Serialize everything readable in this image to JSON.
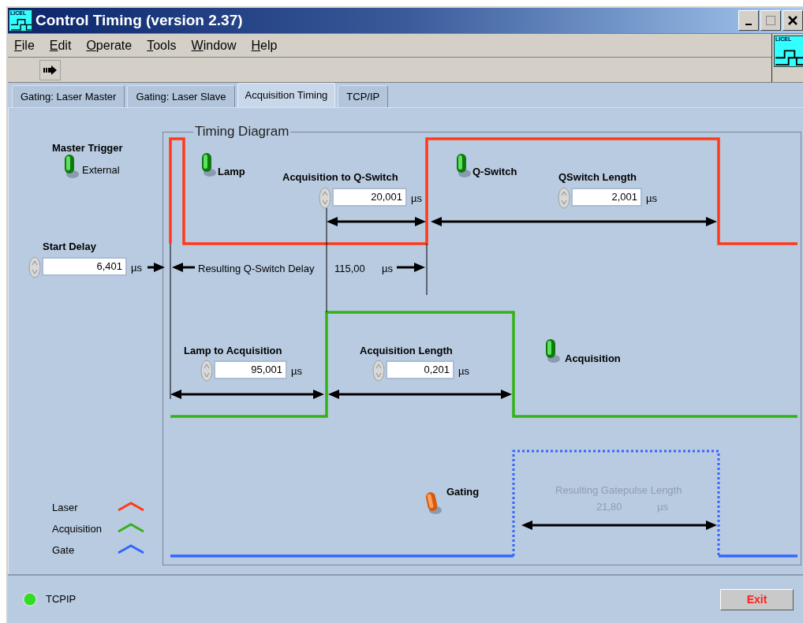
{
  "window": {
    "title": "Control Timing (version 2.37)",
    "logo_text": "LICEL"
  },
  "menu": [
    {
      "label": "File"
    },
    {
      "label": "Edit"
    },
    {
      "label": "Operate"
    },
    {
      "label": "Tools"
    },
    {
      "label": "Window"
    },
    {
      "label": "Help"
    }
  ],
  "toolbar": {
    "logo_text": "LICEL"
  },
  "tabs": [
    {
      "label": "Gating: Laser Master",
      "selected": false
    },
    {
      "label": "Gating: Laser Slave",
      "selected": false
    },
    {
      "label": "Acquisition Timing",
      "selected": true
    },
    {
      "label": "TCP/IP",
      "selected": false
    }
  ],
  "diagram": {
    "title": "Timing Diagram"
  },
  "switches": [
    {
      "label": "Master Trigger",
      "caption": "External",
      "on": true
    },
    {
      "label": "Lamp",
      "on": true
    },
    {
      "label": "Q-Switch",
      "on": true
    },
    {
      "label": "Acquisition",
      "on": true
    },
    {
      "label": "Gating",
      "on": false
    }
  ],
  "numerics": [
    {
      "label": "Start Delay",
      "value": "6,401",
      "unit": "µs"
    },
    {
      "label": "Acquisition to Q-Switch",
      "value": "20,001",
      "unit": "µs"
    },
    {
      "label": "QSwitch Length",
      "value": "2,001",
      "unit": "µs"
    },
    {
      "label": "Lamp to Acquisition",
      "value": "95,001",
      "unit": "µs"
    },
    {
      "label": "Acquisition Length",
      "value": "0,201",
      "unit": "µs"
    }
  ],
  "indicators": [
    {
      "label": "Resulting Q-Switch Delay",
      "value": "115,00",
      "unit": "µs",
      "disabled": false
    },
    {
      "label": "Resulting Gatepulse Length",
      "value": "21,80",
      "unit": "µs",
      "disabled": true
    }
  ],
  "legend": [
    {
      "label": "Laser",
      "color": "#ff3a1a"
    },
    {
      "label": "Acquisition",
      "color": "#33b31a"
    },
    {
      "label": "Gate",
      "color": "#3366ff"
    }
  ],
  "status": {
    "label": "TCPIP",
    "on": true
  },
  "buttons": [
    {
      "label": "Exit"
    }
  ]
}
